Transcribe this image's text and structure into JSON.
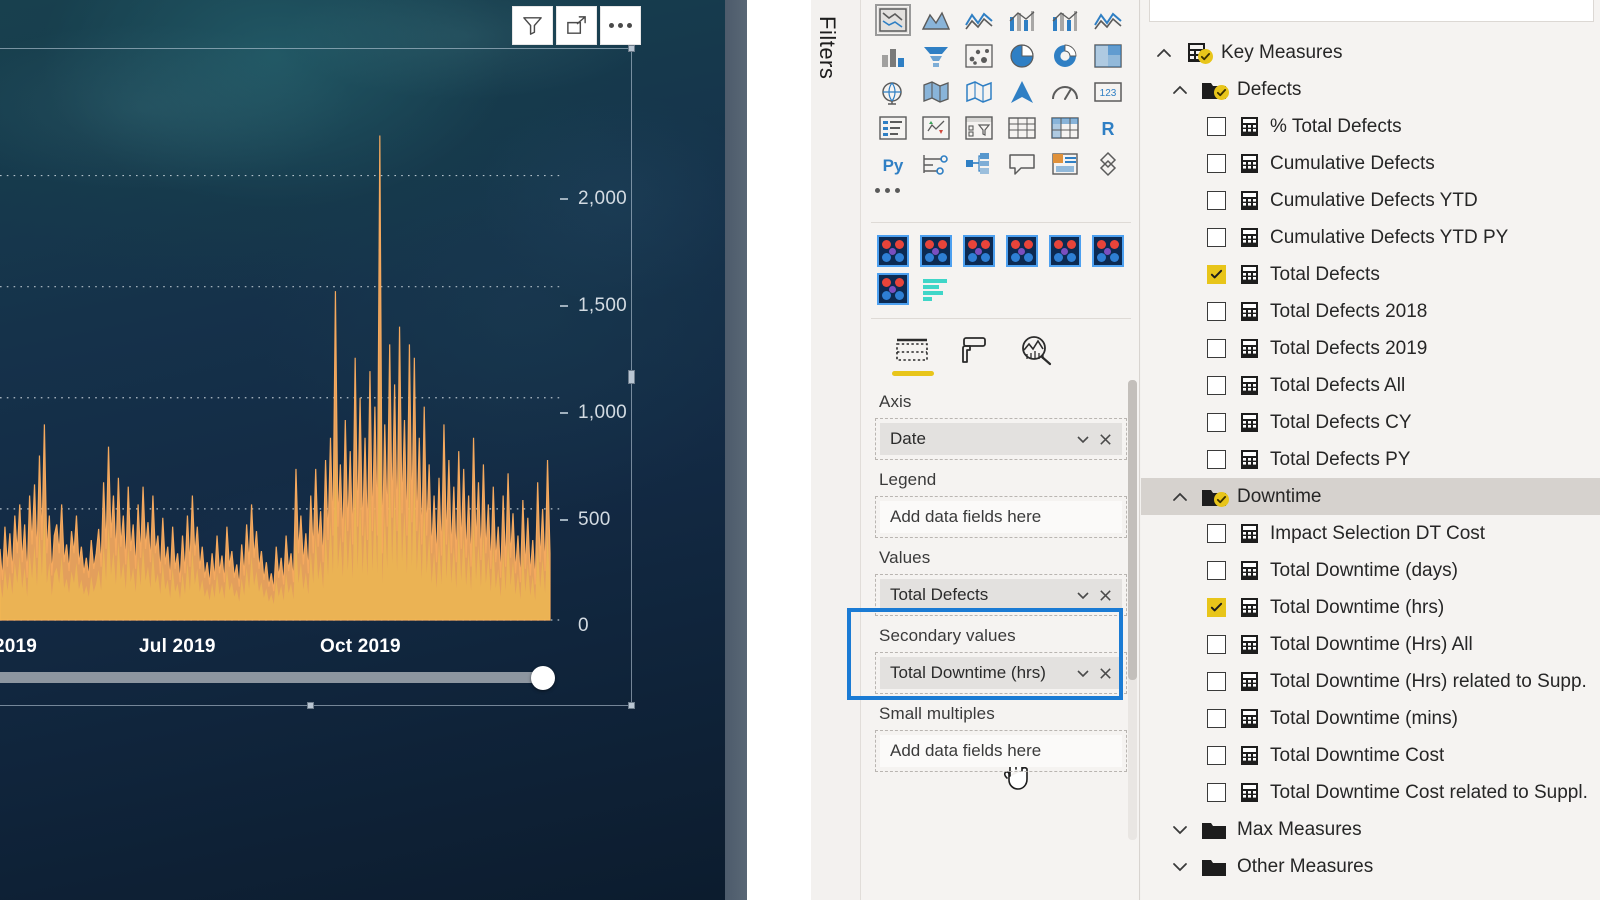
{
  "canvas": {
    "visual_header_buttons": [
      {
        "name": "filter-icon",
        "label": "Filters"
      },
      {
        "name": "focus-mode-icon",
        "label": "Focus mode"
      },
      {
        "name": "more-options-icon",
        "label": "More options"
      }
    ],
    "chart_data": {
      "type": "area",
      "title": "",
      "xlabel": "",
      "ylabel": "",
      "series": [
        {
          "name": "Total Defects",
          "color": "#f5a95e"
        }
      ],
      "ylim": [
        0,
        2250
      ],
      "yticks": [
        "0",
        "500",
        "1,000",
        "1,500",
        "2,000"
      ],
      "xticks": [
        "2019",
        "Jul 2019",
        "Oct 2019"
      ],
      "grid": true,
      "legend": "none",
      "values": [
        320,
        180,
        420,
        240,
        390,
        210,
        470,
        300,
        520,
        260,
        430,
        190,
        560,
        340,
        610,
        280,
        740,
        360,
        880,
        300,
        470,
        200,
        380,
        430,
        300,
        520,
        260,
        340,
        220,
        400,
        300,
        470,
        250,
        330,
        210,
        280,
        190,
        360,
        230,
        300,
        410,
        240,
        620,
        320,
        780,
        370,
        560,
        290,
        640,
        330,
        470,
        250,
        600,
        310,
        430,
        230,
        520,
        280,
        600,
        320,
        440,
        260,
        560,
        300,
        380,
        210,
        460,
        250,
        330,
        180,
        420,
        230,
        300,
        170,
        380,
        210,
        470,
        240,
        560,
        290,
        420,
        230,
        330,
        190,
        260,
        160,
        300,
        180,
        380,
        210,
        290,
        170,
        420,
        240,
        310,
        190,
        250,
        150,
        340,
        200,
        430,
        250,
        520,
        280,
        400,
        230,
        310,
        180,
        260,
        150,
        210,
        130,
        330,
        190,
        280,
        160,
        380,
        220,
        300,
        170,
        680,
        300,
        470,
        250,
        390,
        210,
        560,
        300,
        680,
        330,
        490,
        260,
        720,
        360,
        820,
        380,
        1480,
        420,
        700,
        350,
        900,
        400,
        760,
        340,
        1180,
        420,
        1000,
        380,
        820,
        360,
        1120,
        400,
        960,
        380,
        2180,
        300,
        880,
        420,
        1240,
        460,
        1060,
        400,
        1320,
        480,
        900,
        380,
        1240,
        440,
        1180,
        400,
        820,
        340,
        960,
        380,
        700,
        300,
        560,
        260,
        640,
        290,
        880,
        340,
        720,
        300,
        600,
        260,
        760,
        320,
        680,
        280,
        560,
        240,
        820,
        330,
        620,
        270,
        700,
        300,
        520,
        230,
        600,
        260,
        420,
        190,
        560,
        240,
        660,
        280,
        480,
        210,
        380,
        170,
        540,
        230,
        460,
        200,
        360,
        160,
        620,
        260,
        500,
        220,
        720,
        300
      ]
    },
    "axis_scroll": {
      "name": "horizontal-scrollbar",
      "position_pct": 95
    }
  },
  "filters_pane": {
    "collapsed_label": "Filters"
  },
  "viz_pane": {
    "chart_type_icons": [
      "stacked-bar-chart-icon",
      "stacked-column-chart-icon",
      "clustered-bar-chart-icon",
      "clustered-column-chart-icon",
      "hundred-stacked-bar-icon",
      "hundred-stacked-column-icon",
      "line-chart-icon",
      "area-chart-icon",
      "stacked-area-chart-icon",
      "line-stacked-column-icon",
      "line-clustered-column-icon",
      "ribbon-chart-icon",
      "waterfall-chart-icon",
      "funnel-chart-icon",
      "scatter-chart-icon",
      "pie-chart-icon",
      "donut-chart-icon",
      "treemap-icon",
      "map-icon",
      "filled-map-icon",
      "shape-map-icon",
      "arcgis-map-icon",
      "gauge-icon",
      "card-icon",
      "multi-row-card-icon",
      "kpi-icon",
      "slicer-icon",
      "table-icon",
      "matrix-icon",
      "r-script-visual-icon",
      "python-visual-icon",
      "key-influencers-icon",
      "decomposition-tree-icon",
      "q-and-a-icon",
      "paginated-report-icon",
      "smart-narrative-icon"
    ],
    "more_visuals_label": "more-options-ellipsis",
    "custom_visuals": [
      "custom-visual-icon",
      "custom-visual-icon",
      "custom-visual-icon",
      "custom-visual-icon",
      "custom-visual-icon",
      "custom-visual-icon",
      "custom-visual-icon",
      "custom-bar-visual-icon"
    ],
    "tabs": [
      {
        "name": "fields-tab",
        "icon": "fields-table-icon",
        "active": true
      },
      {
        "name": "format-tab",
        "icon": "paint-roller-icon",
        "active": false
      },
      {
        "name": "analytics-tab",
        "icon": "analytics-magnifier-icon",
        "active": false
      }
    ],
    "wells": [
      {
        "label": "Axis",
        "chips": [
          "Date"
        ],
        "placeholder": null
      },
      {
        "label": "Legend",
        "chips": [],
        "placeholder": "Add data fields here"
      },
      {
        "label": "Values",
        "chips": [
          "Total Defects"
        ],
        "placeholder": null
      },
      {
        "label": "Secondary values",
        "chips": [
          "Total Downtime (hrs)"
        ],
        "placeholder": null,
        "highlighted": true
      },
      {
        "label": "Small multiples",
        "chips": [],
        "placeholder": "Add data fields here"
      }
    ]
  },
  "fields_pane": {
    "tree": [
      {
        "type": "group",
        "label": "Key Measures",
        "icon": "measure-table-icon",
        "expanded": true,
        "indent": 0,
        "badge": true
      },
      {
        "type": "folder",
        "label": "Defects",
        "icon": "folder-icon",
        "expanded": true,
        "indent": 1,
        "badge": true
      },
      {
        "type": "measure",
        "label": "% Total Defects",
        "checked": false,
        "indent": 2
      },
      {
        "type": "measure",
        "label": "Cumulative Defects",
        "checked": false,
        "indent": 2
      },
      {
        "type": "measure",
        "label": "Cumulative Defects YTD",
        "checked": false,
        "indent": 2
      },
      {
        "type": "measure",
        "label": "Cumulative Defects YTD PY",
        "checked": false,
        "indent": 2
      },
      {
        "type": "measure",
        "label": "Total Defects",
        "checked": true,
        "indent": 2
      },
      {
        "type": "measure",
        "label": "Total Defects 2018",
        "checked": false,
        "indent": 2
      },
      {
        "type": "measure",
        "label": "Total Defects 2019",
        "checked": false,
        "indent": 2
      },
      {
        "type": "measure",
        "label": "Total Defects All",
        "checked": false,
        "indent": 2
      },
      {
        "type": "measure",
        "label": "Total Defects CY",
        "checked": false,
        "indent": 2
      },
      {
        "type": "measure",
        "label": "Total Defects PY",
        "checked": false,
        "indent": 2
      },
      {
        "type": "folder",
        "label": "Downtime",
        "icon": "folder-icon",
        "expanded": true,
        "indent": 1,
        "badge": true,
        "hovered": true
      },
      {
        "type": "measure",
        "label": "Impact Selection DT Cost",
        "checked": false,
        "indent": 2
      },
      {
        "type": "measure",
        "label": "Total Downtime (days)",
        "checked": false,
        "indent": 2
      },
      {
        "type": "measure",
        "label": "Total Downtime (hrs)",
        "checked": true,
        "indent": 2
      },
      {
        "type": "measure",
        "label": "Total Downtime (Hrs) All",
        "checked": false,
        "indent": 2
      },
      {
        "type": "measure",
        "label": "Total Downtime (Hrs) related to Supp.",
        "checked": false,
        "indent": 2
      },
      {
        "type": "measure",
        "label": "Total Downtime (mins)",
        "checked": false,
        "indent": 2
      },
      {
        "type": "measure",
        "label": "Total Downtime Cost",
        "checked": false,
        "indent": 2
      },
      {
        "type": "measure",
        "label": "Total Downtime Cost related to Suppl.",
        "checked": false,
        "indent": 2
      },
      {
        "type": "folder",
        "label": "Max Measures",
        "icon": "folder-icon",
        "expanded": false,
        "indent": 1,
        "badge": false
      },
      {
        "type": "folder",
        "label": "Other Measures",
        "icon": "folder-icon",
        "expanded": false,
        "indent": 1,
        "badge": false
      }
    ]
  },
  "colors": {
    "series_orange": "#f5a95e",
    "highlight_blue": "#1a7bd4",
    "check_yellow": "#e8c51a",
    "canvas_dark": "#132b46",
    "pane_bg": "#f5f3f1"
  }
}
